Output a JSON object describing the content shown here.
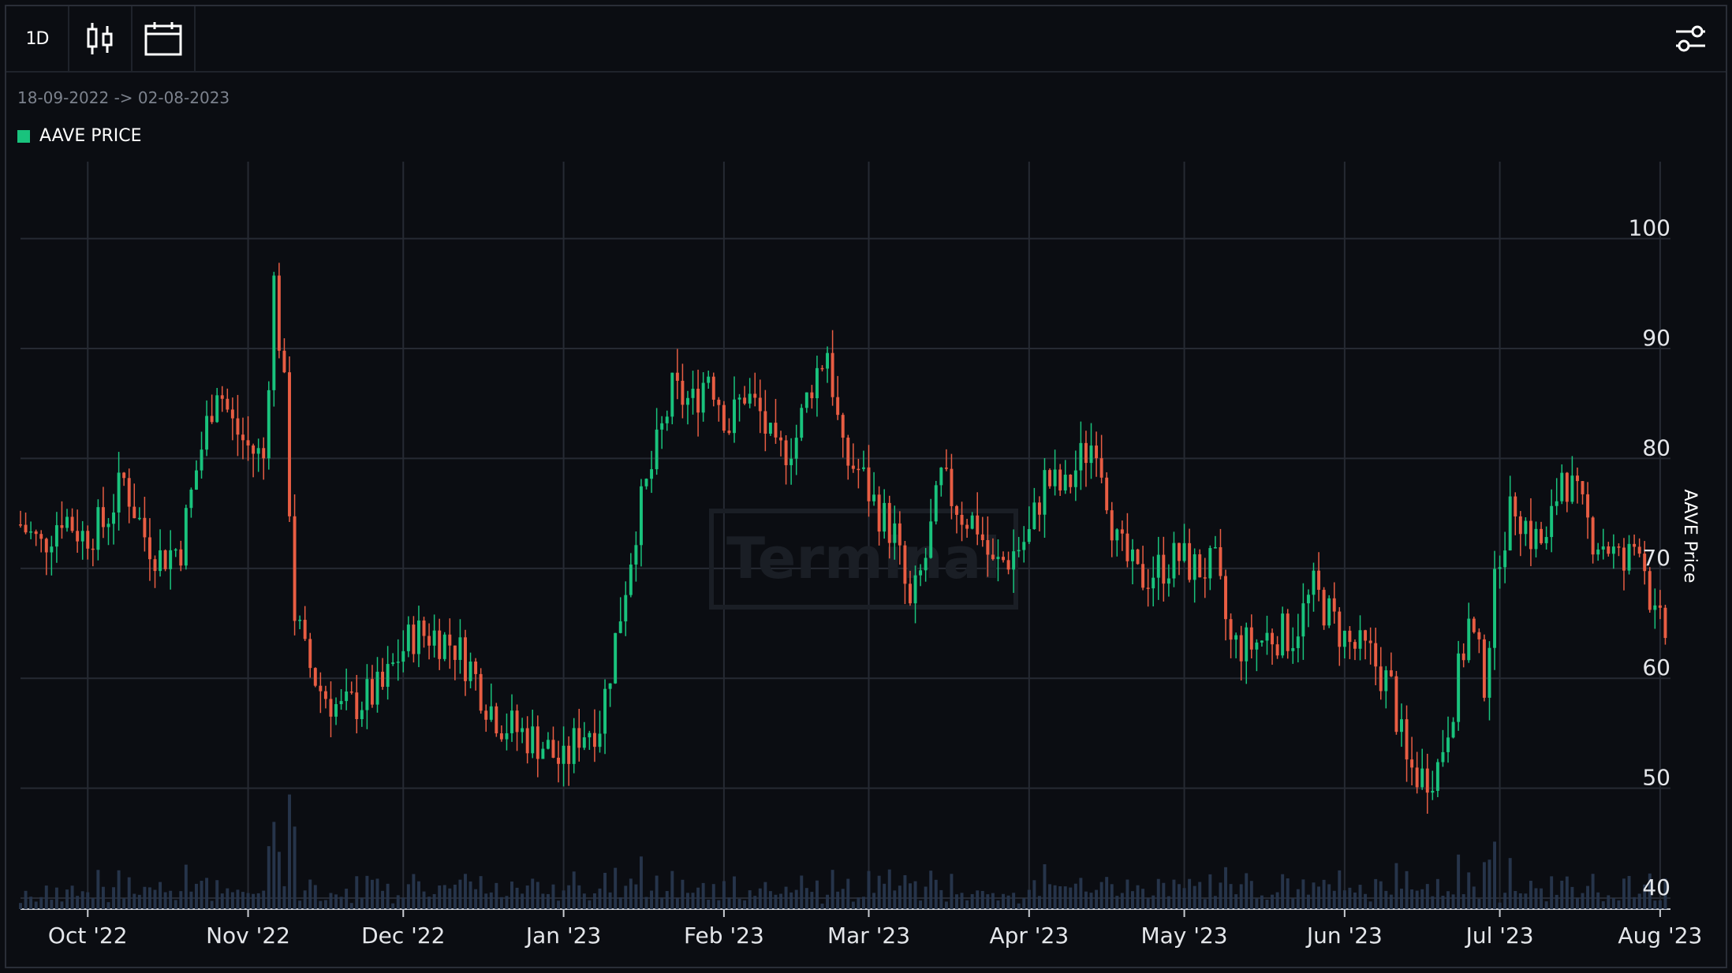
{
  "toolbar": {
    "interval_label": "1D",
    "candle_icon": "candlestick-icon",
    "calendar_icon": "calendar-icon",
    "settings_icon": "sliders-icon"
  },
  "date_range": "18-09-2022 -> 02-08-2023",
  "legend": {
    "label": "AAVE PRICE",
    "color": "#19c37d"
  },
  "colors": {
    "up": "#19c37d",
    "down": "#e85d43",
    "volume": "#26344a",
    "grid": "#262a33",
    "background": "#0b0d12"
  },
  "watermark": "Terminal",
  "chart_data": {
    "type": "candlestick",
    "interval": "1D",
    "y_axis_title": "AAVE Price",
    "y_ticks": [
      40,
      50,
      60,
      70,
      80,
      90,
      100
    ],
    "ylim": [
      39,
      107
    ],
    "x_ticks": [
      {
        "label": "Oct '22",
        "date": "2022-10-01"
      },
      {
        "label": "Nov '22",
        "date": "2022-11-01"
      },
      {
        "label": "Dec '22",
        "date": "2022-12-01"
      },
      {
        "label": "Jan '23",
        "date": "2023-01-01"
      },
      {
        "label": "Feb '23",
        "date": "2023-02-01"
      },
      {
        "label": "Mar '23",
        "date": "2023-03-01"
      },
      {
        "label": "Apr '23",
        "date": "2023-04-01"
      },
      {
        "label": "May '23",
        "date": "2023-05-01"
      },
      {
        "label": "Jun '23",
        "date": "2023-06-01"
      },
      {
        "label": "Jul '23",
        "date": "2023-07-01"
      },
      {
        "label": "Aug '23",
        "date": "2023-08-01"
      }
    ],
    "x_range": [
      "2022-09-18",
      "2023-08-03"
    ],
    "grid": true,
    "close_series": [
      [
        "2022-09-18",
        74
      ],
      [
        "2022-09-22",
        72
      ],
      [
        "2022-09-26",
        75
      ],
      [
        "2022-09-30",
        73
      ],
      [
        "2022-10-04",
        74
      ],
      [
        "2022-10-08",
        78
      ],
      [
        "2022-10-12",
        73
      ],
      [
        "2022-10-15",
        71
      ],
      [
        "2022-10-19",
        72
      ],
      [
        "2022-10-22",
        79
      ],
      [
        "2022-10-26",
        87
      ],
      [
        "2022-10-29",
        83
      ],
      [
        "2022-11-01",
        81
      ],
      [
        "2022-11-04",
        80
      ],
      [
        "2022-11-06",
        96
      ],
      [
        "2022-11-08",
        86
      ],
      [
        "2022-11-10",
        66
      ],
      [
        "2022-11-12",
        62
      ],
      [
        "2022-11-15",
        59
      ],
      [
        "2022-11-19",
        57
      ],
      [
        "2022-11-23",
        58
      ],
      [
        "2022-11-27",
        59
      ],
      [
        "2022-11-30",
        62
      ],
      [
        "2022-12-03",
        64
      ],
      [
        "2022-12-07",
        64
      ],
      [
        "2022-12-11",
        63
      ],
      [
        "2022-12-14",
        61
      ],
      [
        "2022-12-17",
        58
      ],
      [
        "2022-12-20",
        56
      ],
      [
        "2022-12-24",
        55
      ],
      [
        "2022-12-28",
        54
      ],
      [
        "2023-01-01",
        52
      ],
      [
        "2023-01-04",
        55
      ],
      [
        "2023-01-08",
        56
      ],
      [
        "2023-01-12",
        66
      ],
      [
        "2023-01-15",
        74
      ],
      [
        "2023-01-18",
        79
      ],
      [
        "2023-01-22",
        86
      ],
      [
        "2023-01-26",
        85
      ],
      [
        "2023-01-29",
        88
      ],
      [
        "2023-02-02",
        83
      ],
      [
        "2023-02-05",
        86
      ],
      [
        "2023-02-08",
        84
      ],
      [
        "2023-02-11",
        80
      ],
      [
        "2023-02-15",
        82
      ],
      [
        "2023-02-18",
        87
      ],
      [
        "2023-02-21",
        90
      ],
      [
        "2023-02-24",
        80
      ],
      [
        "2023-02-27",
        79
      ],
      [
        "2023-03-02",
        76
      ],
      [
        "2023-03-06",
        73
      ],
      [
        "2023-03-09",
        66
      ],
      [
        "2023-03-12",
        71
      ],
      [
        "2023-03-15",
        78
      ],
      [
        "2023-03-19",
        75
      ],
      [
        "2023-03-22",
        74
      ],
      [
        "2023-03-25",
        70
      ],
      [
        "2023-03-28",
        71
      ],
      [
        "2023-04-01",
        73
      ],
      [
        "2023-04-04",
        78
      ],
      [
        "2023-04-08",
        77
      ],
      [
        "2023-04-11",
        80
      ],
      [
        "2023-04-14",
        82
      ],
      [
        "2023-04-18",
        72
      ],
      [
        "2023-04-22",
        69
      ],
      [
        "2023-04-26",
        70
      ],
      [
        "2023-04-30",
        71
      ],
      [
        "2023-05-03",
        70
      ],
      [
        "2023-05-07",
        70
      ],
      [
        "2023-05-10",
        63
      ],
      [
        "2023-05-14",
        63
      ],
      [
        "2023-05-18",
        64
      ],
      [
        "2023-05-22",
        64
      ],
      [
        "2023-05-26",
        68
      ],
      [
        "2023-05-30",
        65
      ],
      [
        "2023-06-02",
        63
      ],
      [
        "2023-06-06",
        62
      ],
      [
        "2023-06-10",
        59
      ],
      [
        "2023-06-13",
        52
      ],
      [
        "2023-06-16",
        51
      ],
      [
        "2023-06-19",
        52
      ],
      [
        "2023-06-22",
        58
      ],
      [
        "2023-06-25",
        65
      ],
      [
        "2023-06-28",
        60
      ],
      [
        "2023-07-01",
        72
      ],
      [
        "2023-07-04",
        76
      ],
      [
        "2023-07-07",
        73
      ],
      [
        "2023-07-10",
        72
      ],
      [
        "2023-07-13",
        79
      ],
      [
        "2023-07-16",
        76
      ],
      [
        "2023-07-19",
        73
      ],
      [
        "2023-07-22",
        72
      ],
      [
        "2023-07-25",
        70
      ],
      [
        "2023-07-28",
        73
      ],
      [
        "2023-07-31",
        65
      ],
      [
        "2023-08-02",
        64
      ]
    ]
  }
}
